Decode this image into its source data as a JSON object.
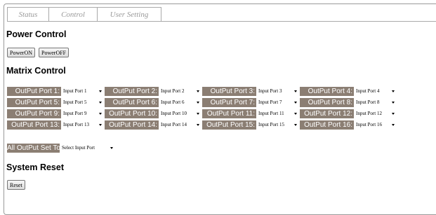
{
  "tabs": [
    "Status",
    "Control",
    "User Setting"
  ],
  "power": {
    "title": "Power Control",
    "on_label": "PowerON",
    "off_label": "PowerOFF"
  },
  "matrix": {
    "title": "Matrix Control",
    "rows": [
      [
        {
          "out": "OutPut Port 1:",
          "in": "Input Port 1"
        },
        {
          "out": "OutPut Port 2:",
          "in": "Input Port 2"
        },
        {
          "out": "OutPut Port 3:",
          "in": "Input Port 3"
        },
        {
          "out": "OutPut Port 4:",
          "in": "Input Port 4"
        }
      ],
      [
        {
          "out": "OutPut Port 5:",
          "in": "Input Port 5"
        },
        {
          "out": "OutPut Port 6:",
          "in": "Input Port 6"
        },
        {
          "out": "OutPut Port 7:",
          "in": "Input Port 7"
        },
        {
          "out": "OutPut Port 8:",
          "in": "Input Port 8"
        }
      ],
      [
        {
          "out": "OutPut Port 9:",
          "in": "Input Port 9"
        },
        {
          "out": "OutPut Port 10:",
          "in": "Input Port 10"
        },
        {
          "out": "OutPut Port 11:",
          "in": "Input Port 11"
        },
        {
          "out": "OutPut Port 12:",
          "in": "Input Port 12"
        }
      ],
      [
        {
          "out": "OutPut Port 13:",
          "in": "Input Port 13"
        },
        {
          "out": "OutPut Port 14:",
          "in": "Input Port 14"
        },
        {
          "out": "OutPut Port 15:",
          "in": "Input Port 15"
        },
        {
          "out": "OutPut Port 16:",
          "in": "Input Port 16"
        }
      ]
    ],
    "all_label": "All OutPut Set To",
    "all_value": "Select Input Port"
  },
  "system": {
    "title": "System Reset",
    "reset_label": "Reset"
  }
}
